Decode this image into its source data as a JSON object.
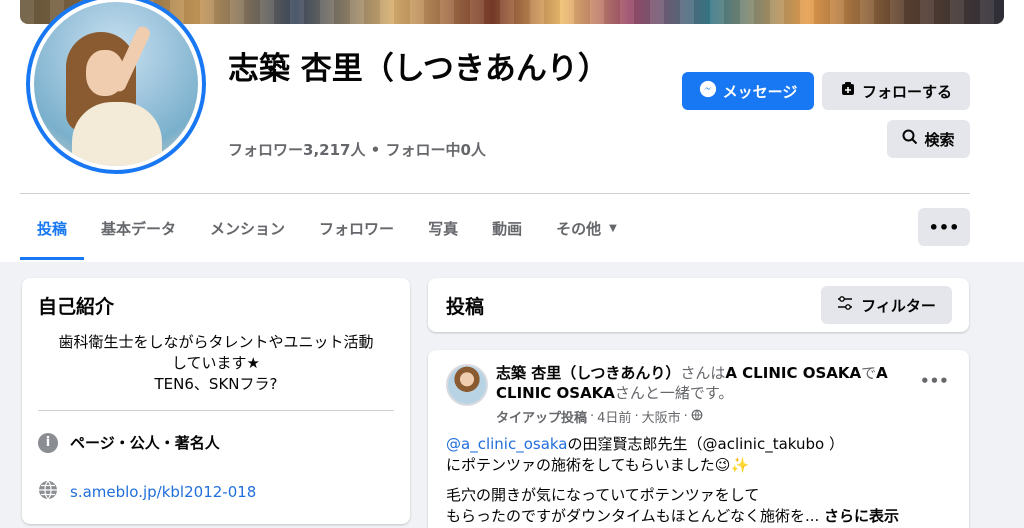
{
  "profile": {
    "name": "志築 杏里（しつきあんり）",
    "followers_text": "フォロワー3,217人 • フォロー中0人"
  },
  "actions": {
    "message_label": "メッセージ",
    "follow_label": "フォローする",
    "search_label": "検索"
  },
  "tabs": [
    {
      "label": "投稿"
    },
    {
      "label": "基本データ"
    },
    {
      "label": "メンション"
    },
    {
      "label": "フォロワー"
    },
    {
      "label": "写真"
    },
    {
      "label": "動画"
    },
    {
      "label": "その他"
    }
  ],
  "more_label": "•••",
  "intro": {
    "title": "自己紹介",
    "bio_line1": "歯科衛生士をしながらタレントやユニット活動",
    "bio_line2": "しています★",
    "bio_line3": "TEN6、SKNフラ?",
    "category": "ページ・公人・著名人",
    "website": "s.ameblo.jp/kbl2012-018"
  },
  "posts_section": {
    "title": "投稿",
    "filter_label": "フィルター"
  },
  "post": {
    "author": "志築 杏里（しつきあんり）",
    "with_text": "さんは",
    "place": "A CLINIC OSAKA",
    "de": "で",
    "tagged": "A CLINIC OSAKA",
    "together": "さんと一緒です。",
    "meta_tieup": "タイアップ投稿",
    "meta_time": "4日前",
    "meta_location": "大阪市",
    "mention_link": "@a_clinic_osaka",
    "line1_rest": "の田窪賢志郎先生（@aclinic_takubo ）",
    "line2": "にポテンツァの施術をしてもらいました😉✨",
    "line3": "毛穴の開きが気になっていてポテンツァをして",
    "line4": "もらったのですがダウンタイムもほとんどなく施術を...",
    "see_more": "さらに表示"
  },
  "colors": {
    "accent": "#1877f2",
    "button_gray": "#e4e6eb",
    "muted_text": "#65676b",
    "page_bg": "#f0f2f5"
  }
}
